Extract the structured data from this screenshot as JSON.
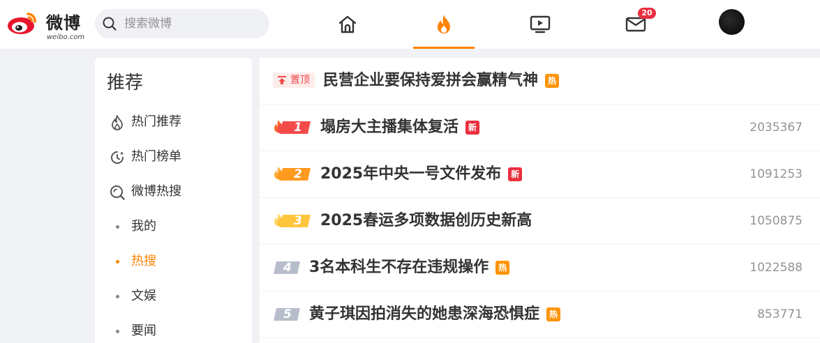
{
  "header": {
    "logo_text": "微博",
    "logo_sub": "weibo.com",
    "search_placeholder": "搜索微博",
    "nav": [
      {
        "name": "home",
        "icon": "home-icon"
      },
      {
        "name": "hot",
        "icon": "flame-icon",
        "active": true
      },
      {
        "name": "video",
        "icon": "video-icon"
      },
      {
        "name": "messages",
        "icon": "mail-icon",
        "badge": "20"
      }
    ],
    "accent_color": "#ff8200"
  },
  "sidebar": {
    "title": "推荐",
    "items": [
      {
        "label": "热门推荐",
        "icon": "flame-outline-icon"
      },
      {
        "label": "热门榜单",
        "icon": "clock-ranking-icon"
      },
      {
        "label": "微博热搜",
        "icon": "search-hot-icon"
      },
      {
        "label": "我的"
      },
      {
        "label": "热搜",
        "active": true
      },
      {
        "label": "文娱"
      },
      {
        "label": "要闻"
      }
    ]
  },
  "hot_list": {
    "pinned": {
      "label": "置顶",
      "topic": "民营企业要保持爱拼会赢精气神",
      "tag": "热"
    },
    "items": [
      {
        "rank": "1",
        "topic": "塌房大主播集体复活",
        "tag": "新",
        "tag_type": "new",
        "count": "2035367"
      },
      {
        "rank": "2",
        "topic": "2025年中央一号文件发布",
        "tag": "新",
        "tag_type": "new",
        "count": "1091253"
      },
      {
        "rank": "3",
        "topic": "2025春运多项数据创历史新高",
        "tag": "",
        "tag_type": "",
        "count": "1050875"
      },
      {
        "rank": "4",
        "topic": "3名本科生不存在违规操作",
        "tag": "热",
        "tag_type": "hot",
        "count": "1022588"
      },
      {
        "rank": "5",
        "topic": "黄子琪因拍消失的她患深海恐惧症",
        "tag": "热",
        "tag_type": "hot",
        "count": "853771"
      }
    ],
    "rank_colors": {
      "1": "#f44a4a",
      "2": "#ff9a1f",
      "3": "#ffc53d",
      "other": "#b8bdcc"
    }
  }
}
